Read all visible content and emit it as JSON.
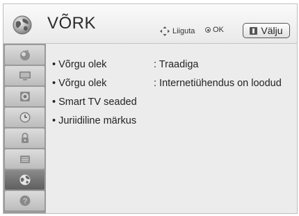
{
  "header": {
    "title": "VÕRK",
    "hints": {
      "move": "Liiguta",
      "ok": "OK"
    },
    "exit_label": "Välju"
  },
  "sidebar": {
    "items": [
      {
        "icon": "picture-icon",
        "active": false
      },
      {
        "icon": "screen-icon",
        "active": false
      },
      {
        "icon": "audio-icon",
        "active": false
      },
      {
        "icon": "clock-icon",
        "active": false
      },
      {
        "icon": "lock-icon",
        "active": false
      },
      {
        "icon": "options-icon",
        "active": false
      },
      {
        "icon": "network-globe-icon",
        "active": true
      },
      {
        "icon": "support-icon",
        "active": false
      }
    ]
  },
  "menu": [
    {
      "label": "• Võrgu olek",
      "value": ": Traadiga"
    },
    {
      "label": "• Võrgu olek",
      "value": ": Internetiühendus on loodud"
    },
    {
      "label": "• Smart TV seaded",
      "value": ""
    },
    {
      "label": "• Juriidiline märkus",
      "value": ""
    }
  ],
  "colors": {
    "background": "#ececec",
    "sidebar": "#9a9a9a",
    "active_item": "#6e6e6e"
  }
}
